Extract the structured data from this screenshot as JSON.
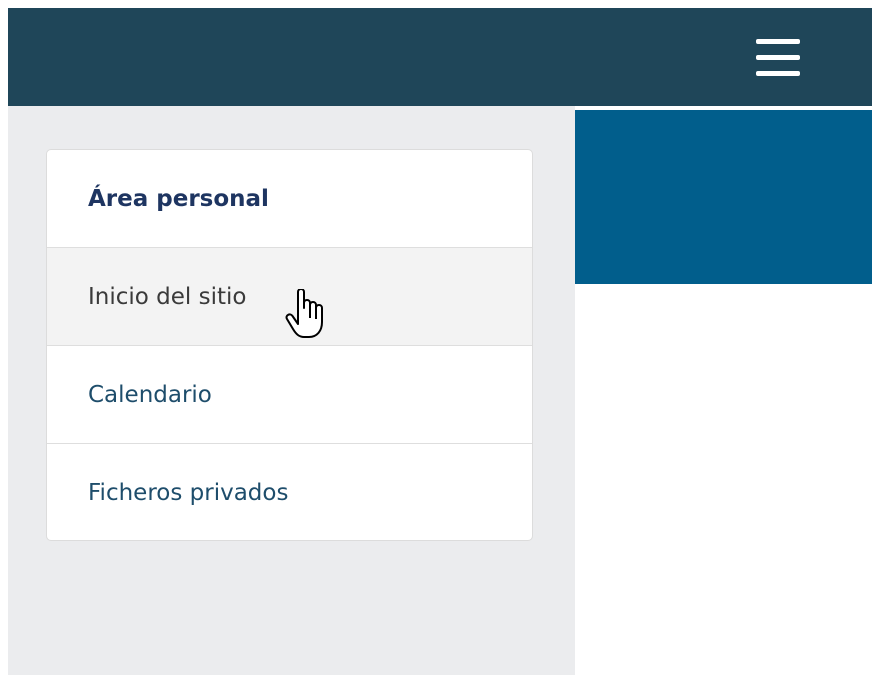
{
  "colors": {
    "navbar_bg": "#1f4659",
    "drawer_bg": "#ebecee",
    "hero_bg": "#015e8c",
    "link_color": "#1e4d6b",
    "header_color": "#1e3561"
  },
  "navbar": {
    "menu_icon": "hamburger-menu-icon"
  },
  "drawer": {
    "header": "Área personal",
    "items": [
      {
        "label": "Inicio del sitio",
        "state": "hover"
      },
      {
        "label": "Calendario",
        "state": "normal"
      },
      {
        "label": "Ficheros privados",
        "state": "normal"
      }
    ]
  },
  "pointer": {
    "icon": "hand-pointer-cursor-icon"
  }
}
